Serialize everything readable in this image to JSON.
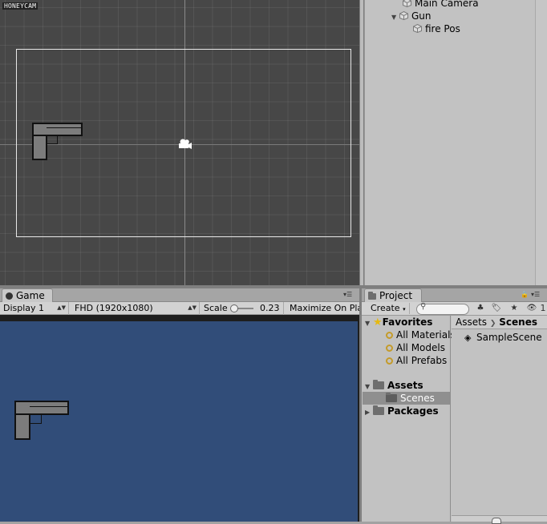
{
  "watermark": "HONEYCAM",
  "hierarchy": {
    "items": [
      {
        "label": "Main Camera",
        "indent": 1,
        "expandable": false
      },
      {
        "label": "Gun",
        "indent": 1,
        "expandable": true,
        "expanded": true
      },
      {
        "label": "fire Pos",
        "indent": 2,
        "expandable": false
      }
    ]
  },
  "game": {
    "tab_label": "Game",
    "display_label": "Display 1",
    "resolution_label": "FHD (1920x1080)",
    "scale_label": "Scale",
    "scale_value": "0.23",
    "maximize_label": "Maximize On Play",
    "background_color": "#314d79"
  },
  "project": {
    "tab_label": "Project",
    "create_label": "Create",
    "favorites_label": "Favorites",
    "favorites": [
      "All Materials",
      "All Models",
      "All Prefabs"
    ],
    "assets_label": "Assets",
    "scenes_label": "Scenes",
    "packages_label": "Packages",
    "breadcrumb": {
      "root": "Assets",
      "current": "Scenes"
    },
    "scene_item": "SampleScene",
    "badge_count": "1"
  }
}
